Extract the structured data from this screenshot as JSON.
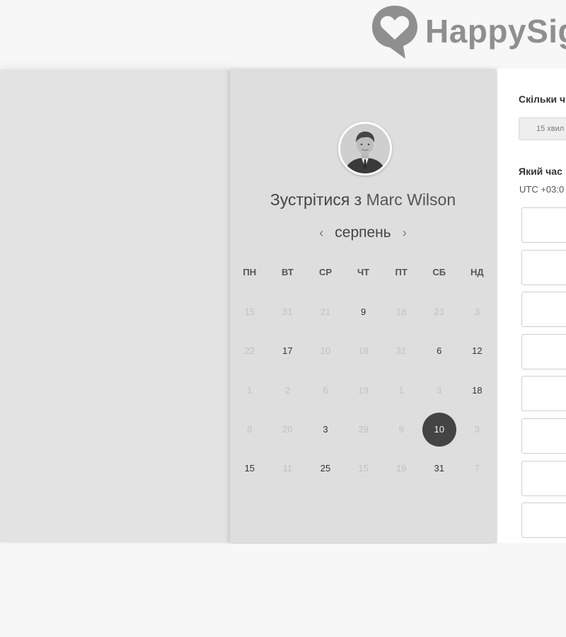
{
  "brand": {
    "name": "HappySig",
    "logo_color": "#8f8f8f"
  },
  "meeting": {
    "heading_prefix": "Зустрітися з",
    "host_name": "Marc Wilson"
  },
  "calendar": {
    "month": "серпень",
    "prev_icon": "chevron-left-icon",
    "next_icon": "chevron-right-icon",
    "prev_label": "‹",
    "next_label": "›",
    "weekdays": [
      "ПН",
      "ВТ",
      "СР",
      "ЧТ",
      "ПТ",
      "СБ",
      "НД"
    ],
    "selected_color": "#444444",
    "days": [
      {
        "label": "15",
        "available": false
      },
      {
        "label": "31",
        "available": false
      },
      {
        "label": "21",
        "available": false
      },
      {
        "label": "9",
        "available": true
      },
      {
        "label": "18",
        "available": false
      },
      {
        "label": "23",
        "available": false
      },
      {
        "label": "3",
        "available": false
      },
      {
        "label": "22",
        "available": false
      },
      {
        "label": "17",
        "available": true
      },
      {
        "label": "10",
        "available": false
      },
      {
        "label": "18",
        "available": false
      },
      {
        "label": "31",
        "available": false
      },
      {
        "label": "6",
        "available": true
      },
      {
        "label": "12",
        "available": true
      },
      {
        "label": "1",
        "available": false
      },
      {
        "label": "2",
        "available": false
      },
      {
        "label": "6",
        "available": false
      },
      {
        "label": "19",
        "available": false
      },
      {
        "label": "1",
        "available": false
      },
      {
        "label": "3",
        "available": false
      },
      {
        "label": "18",
        "available": true
      },
      {
        "label": "8",
        "available": false
      },
      {
        "label": "20",
        "available": false
      },
      {
        "label": "3",
        "available": true
      },
      {
        "label": "29",
        "available": false
      },
      {
        "label": "9",
        "available": false
      },
      {
        "label": "10",
        "available": true,
        "selected": true
      },
      {
        "label": "3",
        "available": false
      },
      {
        "label": "15",
        "available": true
      },
      {
        "label": "11",
        "available": false
      },
      {
        "label": "25",
        "available": true
      },
      {
        "label": "15",
        "available": false
      },
      {
        "label": "19",
        "available": false
      },
      {
        "label": "31",
        "available": true
      },
      {
        "label": "7",
        "available": false
      }
    ]
  },
  "booking": {
    "duration_title": "Скільки ч",
    "duration_option": "15 хвил",
    "time_title": "Який час",
    "timezone": "UTC +03:0",
    "slot_count": 8
  }
}
